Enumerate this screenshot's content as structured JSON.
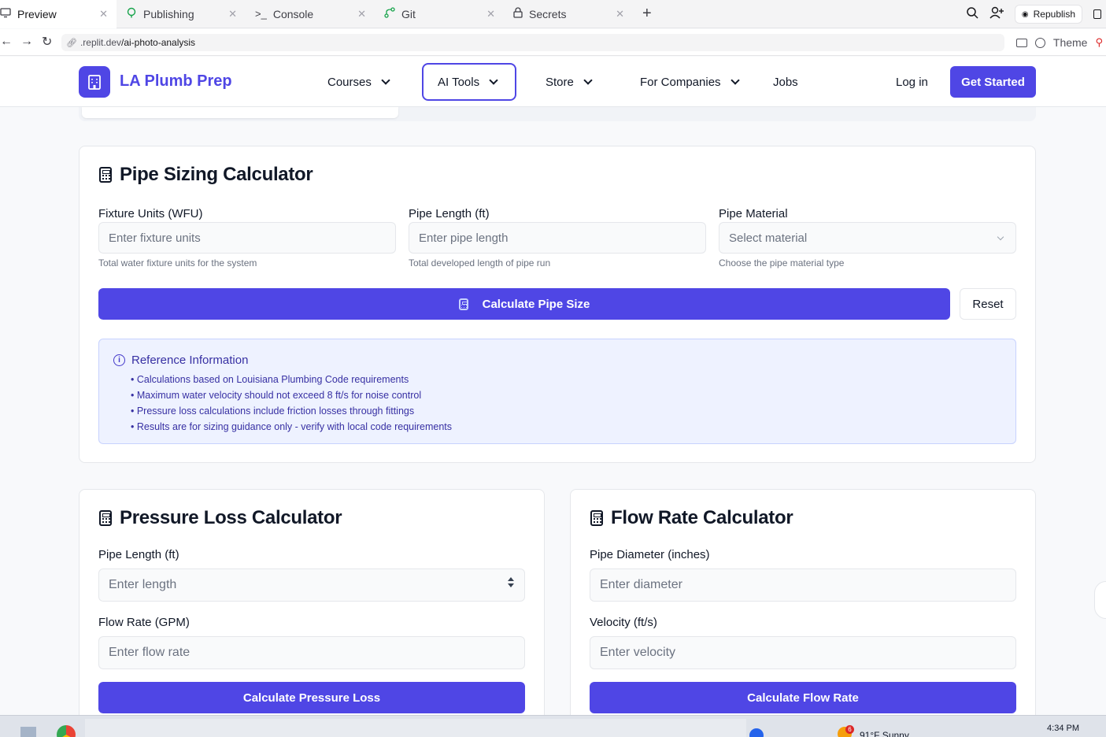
{
  "ide_tabs": [
    {
      "label": "Preview",
      "icon": "monitor-icon",
      "active": true
    },
    {
      "label": "Publishing",
      "icon": "publish-icon",
      "active": false
    },
    {
      "label": "Console",
      "icon": "terminal-icon",
      "active": false
    },
    {
      "label": "Git",
      "icon": "git-icon",
      "active": false
    },
    {
      "label": "Secrets",
      "icon": "lock-icon",
      "active": false
    }
  ],
  "ide_actions": {
    "republish_label": "Republish",
    "theme_label": "Theme"
  },
  "url": {
    "domain": ".replit.dev",
    "path": "/ai-photo-analysis"
  },
  "site": {
    "brand": "LA Plumb Prep",
    "nav": {
      "courses": "Courses",
      "ai_tools": "AI Tools",
      "store": "Store",
      "for_companies": "For Companies",
      "jobs": "Jobs"
    },
    "login": "Log in",
    "get_started": "Get Started"
  },
  "pipe_sizing": {
    "title": "Pipe Sizing Calculator",
    "fixture_units": {
      "label": "Fixture Units (WFU)",
      "placeholder": "Enter fixture units",
      "help": "Total water fixture units for the system"
    },
    "pipe_length": {
      "label": "Pipe Length (ft)",
      "placeholder": "Enter pipe length",
      "help": "Total developed length of pipe run"
    },
    "pipe_material": {
      "label": "Pipe Material",
      "placeholder": "Select material",
      "help": "Choose the pipe material type"
    },
    "calculate_label": "Calculate Pipe Size",
    "reset_label": "Reset",
    "reference": {
      "title": "Reference Information",
      "items": [
        "• Calculations based on Louisiana Plumbing Code requirements",
        "• Maximum water velocity should not exceed 8 ft/s for noise control",
        "• Pressure loss calculations include friction losses through fittings",
        "• Results are for sizing guidance only - verify with local code requirements"
      ]
    }
  },
  "pressure_loss": {
    "title": "Pressure Loss Calculator",
    "pipe_length": {
      "label": "Pipe Length (ft)",
      "placeholder": "Enter length"
    },
    "flow_rate": {
      "label": "Flow Rate (GPM)",
      "placeholder": "Enter flow rate"
    },
    "calculate_label": "Calculate Pressure Loss"
  },
  "flow_rate": {
    "title": "Flow Rate Calculator",
    "pipe_diameter": {
      "label": "Pipe Diameter (inches)",
      "placeholder": "Enter diameter"
    },
    "velocity": {
      "label": "Velocity (ft/s)",
      "placeholder": "Enter velocity"
    },
    "calculate_label": "Calculate Flow Rate"
  },
  "taskbar": {
    "time": "4:34 PM",
    "weather": "91°F  Sunny",
    "notification_count": "6"
  },
  "colors": {
    "primary": "#4f46e5",
    "reference_bg": "#eef2ff",
    "reference_text": "#3730a3"
  }
}
